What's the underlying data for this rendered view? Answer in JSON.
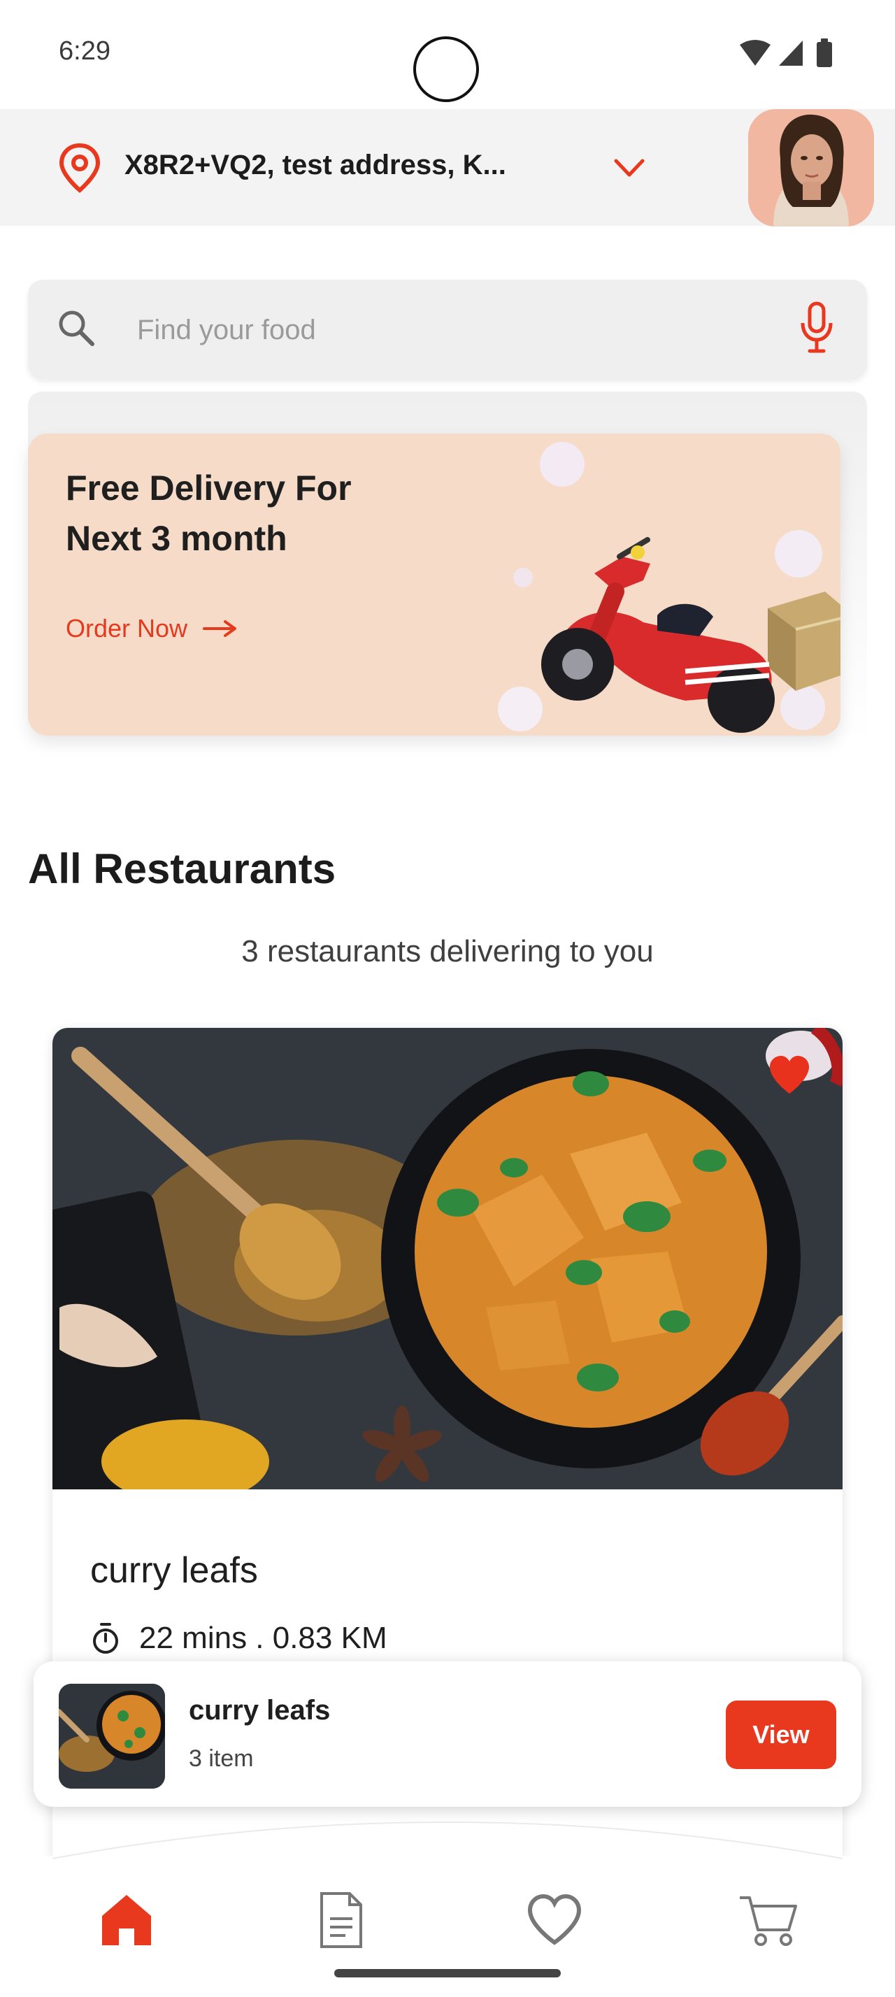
{
  "status_bar": {
    "time": "6:29",
    "icons": [
      "wifi-icon",
      "signal-icon",
      "battery-icon"
    ]
  },
  "location": {
    "address": "X8R2+VQ2, test address, K...",
    "icon": "location-pin-icon",
    "dropdown_icon": "chevron-down-icon"
  },
  "search": {
    "placeholder": "Find your food",
    "value": "",
    "search_icon": "search-icon",
    "mic_icon": "microphone-icon"
  },
  "promo": {
    "title_line1": "Free Delivery For",
    "title_line2": "Next 3 month",
    "cta_label": "Order Now",
    "cta_icon": "arrow-right-icon"
  },
  "restaurants": {
    "section_title": "All Restaurants",
    "subtitle": "3 restaurants delivering to you",
    "items": [
      {
        "name": "curry leafs",
        "delivery_time": "22 mins . 0.83 KM",
        "favorited": true
      }
    ]
  },
  "cart": {
    "restaurant_name": "curry leafs",
    "item_count": "3 item",
    "view_label": "View"
  },
  "bottom_nav": {
    "items": [
      "home-icon",
      "orders-icon",
      "favorites-icon",
      "cart-icon"
    ],
    "active": "home-icon"
  },
  "colors": {
    "accent": "#e8391e",
    "promo_background": "#f6dcc8",
    "search_background": "#efefef",
    "location_bar_background": "#f3f3f3"
  }
}
